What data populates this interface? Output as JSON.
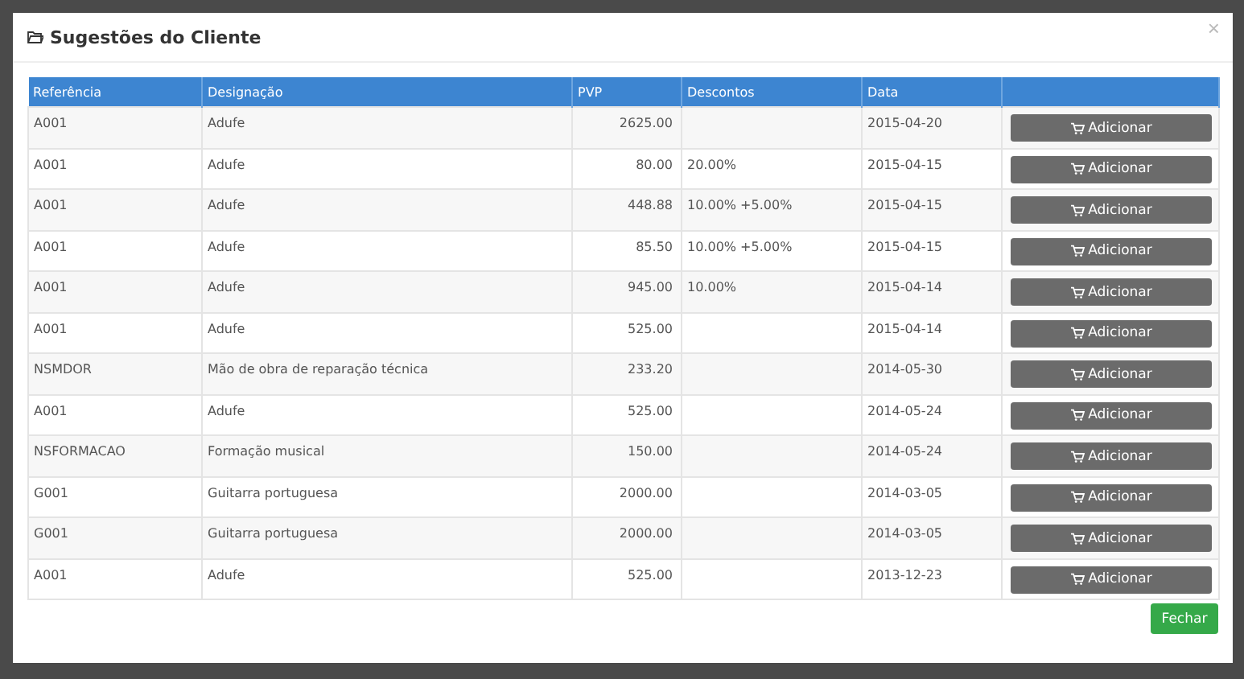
{
  "modal": {
    "title": "Sugestões do Cliente",
    "close": "×"
  },
  "table": {
    "columns": [
      "Referência",
      "Designação",
      "PVP",
      "Descontos",
      "Data"
    ],
    "rows": [
      {
        "ref": "A001",
        "designation": "Adufe",
        "pvp": "2625.00",
        "discounts": "",
        "date": "2015-04-20",
        "action": "Adicionar"
      },
      {
        "ref": "A001",
        "designation": "Adufe",
        "pvp": "80.00",
        "discounts": "20.00%",
        "date": "2015-04-15",
        "action": "Adicionar"
      },
      {
        "ref": "A001",
        "designation": "Adufe",
        "pvp": "448.88",
        "discounts": "10.00% +5.00%",
        "date": "2015-04-15",
        "action": "Adicionar"
      },
      {
        "ref": "A001",
        "designation": "Adufe",
        "pvp": "85.50",
        "discounts": "10.00% +5.00%",
        "date": "2015-04-15",
        "action": "Adicionar"
      },
      {
        "ref": "A001",
        "designation": "Adufe",
        "pvp": "945.00",
        "discounts": "10.00%",
        "date": "2015-04-14",
        "action": "Adicionar"
      },
      {
        "ref": "A001",
        "designation": "Adufe",
        "pvp": "525.00",
        "discounts": "",
        "date": "2015-04-14",
        "action": "Adicionar"
      },
      {
        "ref": "NSMDOR",
        "designation": "Mão de obra de reparação técnica",
        "pvp": "233.20",
        "discounts": "",
        "date": "2014-05-30",
        "action": "Adicionar"
      },
      {
        "ref": "A001",
        "designation": "Adufe",
        "pvp": "525.00",
        "discounts": "",
        "date": "2014-05-24",
        "action": "Adicionar"
      },
      {
        "ref": "NSFORMACAO",
        "designation": "Formação musical",
        "pvp": "150.00",
        "discounts": "",
        "date": "2014-05-24",
        "action": "Adicionar"
      },
      {
        "ref": "G001",
        "designation": "Guitarra portuguesa",
        "pvp": "2000.00",
        "discounts": "",
        "date": "2014-03-05",
        "action": "Adicionar"
      },
      {
        "ref": "G001",
        "designation": "Guitarra portuguesa",
        "pvp": "2000.00",
        "discounts": "",
        "date": "2014-03-05",
        "action": "Adicionar"
      },
      {
        "ref": "A001",
        "designation": "Adufe",
        "pvp": "525.00",
        "discounts": "",
        "date": "2013-12-23",
        "action": "Adicionar"
      }
    ]
  },
  "footer": {
    "button": "Fechar"
  }
}
